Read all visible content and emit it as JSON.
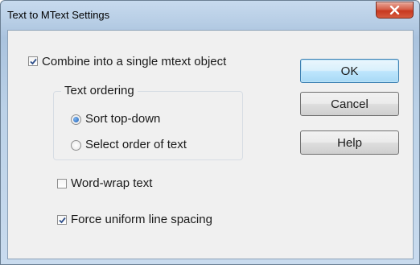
{
  "window": {
    "title": "Text to MText Settings"
  },
  "options": {
    "combine_label": "Combine into a single mtext object",
    "combine_checked": true,
    "ordering_group_title": "Text ordering",
    "sort_top_down_label": "Sort top-down",
    "sort_top_down_selected": true,
    "select_order_label": "Select order of text",
    "select_order_selected": false,
    "word_wrap_label": "Word-wrap text",
    "word_wrap_checked": false,
    "force_uniform_label": "Force uniform line spacing",
    "force_uniform_checked": true
  },
  "buttons": {
    "ok": "OK",
    "cancel": "Cancel",
    "help": "Help"
  },
  "colors": {
    "close_button": "#c7381f",
    "check_mark": "#2d4e8a",
    "default_button_border": "#3c7fb1"
  }
}
